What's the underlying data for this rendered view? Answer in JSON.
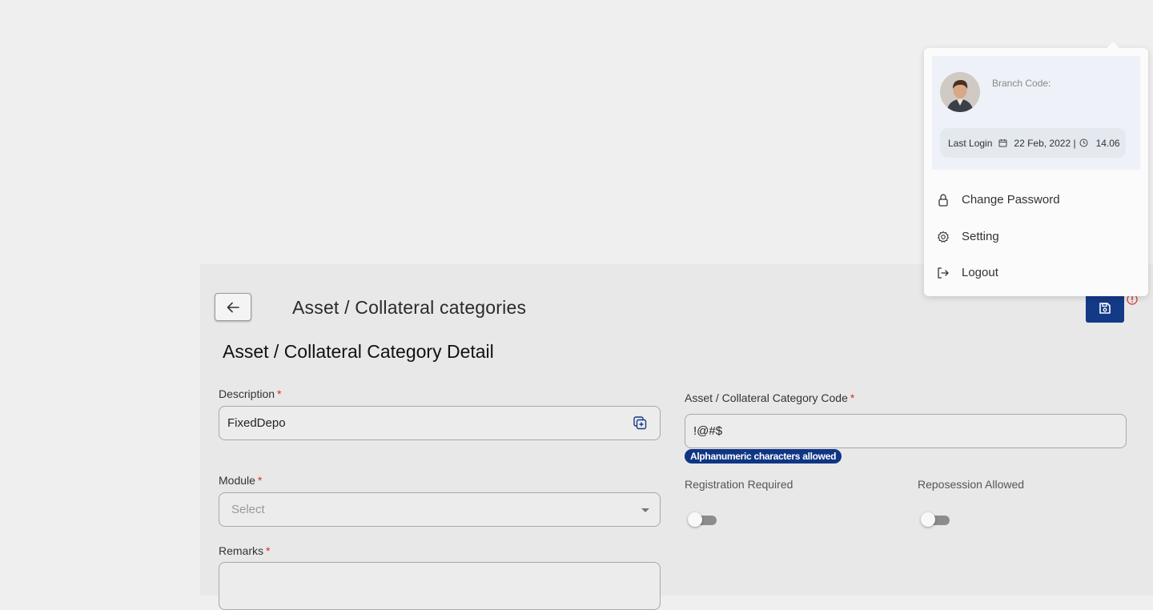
{
  "page": {
    "title": "Asset / Collateral categories",
    "section_title": "Asset / Collateral Category Detail"
  },
  "form": {
    "description": {
      "label": "Description",
      "required_mark": "*",
      "value": "FixedDepo"
    },
    "code": {
      "label": "Asset / Collateral Category Code",
      "required_mark": "*",
      "value": "!@#$",
      "hint": "Alphanumeric characters allowed"
    },
    "module": {
      "label": "Module",
      "required_mark": "*",
      "placeholder": "Select"
    },
    "remarks": {
      "label": "Remarks",
      "required_mark": "*",
      "value": ""
    },
    "registration_required": {
      "label": "Registration Required",
      "enabled": false
    },
    "repossession_allowed": {
      "label": "Reposession Allowed",
      "enabled": false
    }
  },
  "profile_menu": {
    "branch_code_label": "Branch Code:",
    "last_login_label": "Last Login",
    "last_login_date": "22 Feb, 2022 |",
    "last_login_time": "14.06",
    "items": [
      {
        "label": "Change Password",
        "icon": "lock-icon"
      },
      {
        "label": "Setting",
        "icon": "gear-icon"
      },
      {
        "label": "Logout",
        "icon": "logout-icon"
      }
    ]
  },
  "colors": {
    "primary": "#133a87",
    "required": "#d32f2f",
    "background": "#efefef"
  }
}
